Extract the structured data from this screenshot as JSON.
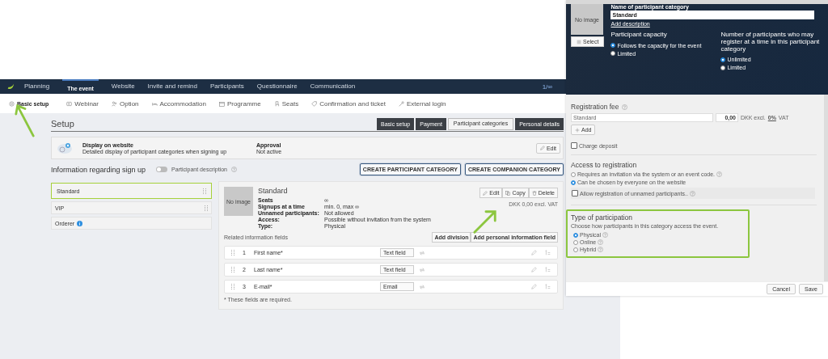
{
  "nav": {
    "items": [
      {
        "label": "Planning",
        "selected": false
      },
      {
        "label": "The event",
        "selected": true
      },
      {
        "label": "Website",
        "selected": false
      },
      {
        "label": "Invite and remind",
        "selected": false
      },
      {
        "label": "Participants",
        "selected": false
      },
      {
        "label": "Questionnaire",
        "selected": false
      },
      {
        "label": "Communication",
        "selected": false
      }
    ],
    "counter": "1/∞"
  },
  "subnav": [
    {
      "label": "Basic setup",
      "selected": true
    },
    {
      "label": "Webinar",
      "selected": false
    },
    {
      "label": "Option",
      "selected": false
    },
    {
      "label": "Accommodation",
      "selected": false
    },
    {
      "label": "Programme",
      "selected": false
    },
    {
      "label": "Seats",
      "selected": false
    },
    {
      "label": "Confirmation and ticket",
      "selected": false
    },
    {
      "label": "External login",
      "selected": false
    }
  ],
  "setup": {
    "title": "Setup",
    "tabs": [
      {
        "label": "Basic setup",
        "selected": false
      },
      {
        "label": "Payment",
        "selected": false
      },
      {
        "label": "Participant categories",
        "selected": true
      },
      {
        "label": "Personal details",
        "selected": false
      }
    ]
  },
  "display_info": {
    "title": "Display on website",
    "text": "Detailed display of participant categories when signing up",
    "approval_label": "Approval",
    "approval_value": "Not active",
    "edit": "Edit"
  },
  "signup": {
    "heading": "Information regarding sign up",
    "toggle": {
      "label": "Participant description",
      "on": false
    },
    "buttons": [
      "CREATE PARTICIPANT CATEGORY",
      "CREATE COMPANION CATEGORY"
    ]
  },
  "categories": [
    {
      "label": "Standard",
      "selected": true,
      "kind": "category"
    },
    {
      "label": "VIP",
      "selected": false,
      "kind": "category"
    },
    {
      "label": "Orderer",
      "selected": false,
      "kind": "orderer"
    }
  ],
  "detail": {
    "image": "No image",
    "name": "Standard",
    "props": [
      {
        "label": "Seats",
        "value": "∞"
      },
      {
        "label": "Signups at a time",
        "value": "min. 0, max ∞"
      },
      {
        "label": "Unnamed participants:",
        "value": "Not allowed"
      },
      {
        "label": "Access:",
        "value": "Possible without invitation from the system"
      },
      {
        "label": "Type:",
        "value": "Physical"
      }
    ],
    "actions": [
      "Edit",
      "Copy",
      "Delete"
    ],
    "price": "DKK 0,00 excl. VAT",
    "related_label": "Related information fields",
    "field_buttons": [
      "Add division",
      "Add personal information field"
    ],
    "fields": [
      {
        "number": "1",
        "name": "First name*",
        "type": "Text field"
      },
      {
        "number": "2",
        "name": "Last name*",
        "type": "Text field"
      },
      {
        "number": "3",
        "name": "E-mail*",
        "type": "Email"
      }
    ],
    "footnote": "* These fields are required."
  },
  "panel": {
    "image": "No image",
    "select": "Select",
    "name_label": "Name of participant category",
    "name_value": "Standard",
    "add_description": "Add description",
    "capacity": {
      "title": "Participant capacity",
      "options": [
        {
          "label": "Follows the capacity for the event",
          "selected": true
        },
        {
          "label": "Limited",
          "selected": false
        }
      ]
    },
    "per_signup": {
      "title": "Number of participants who may register at a time in this participant category",
      "options": [
        {
          "label": "Unlimited",
          "selected": true
        },
        {
          "label": "Limited",
          "selected": false
        }
      ]
    },
    "fee": {
      "title": "Registration fee",
      "name": "Standard",
      "amount": "0,00",
      "currency": "DKK excl.",
      "vat": "0%",
      "vat_suffix": "VAT",
      "add": "Add"
    },
    "deposit": {
      "label": "Charge deposit",
      "checked": false
    },
    "access": {
      "title": "Access to registration",
      "options": [
        {
          "label": "Requires an invitation via the system or an event code.",
          "selected": false
        },
        {
          "label": "Can be chosen by everyone on the website",
          "selected": true
        }
      ],
      "unnamed": {
        "label": "Allow registration of unnamed participants..",
        "checked": false
      }
    },
    "participation": {
      "title": "Type of participation",
      "text": "Choose how participants in this category access the event.",
      "options": [
        {
          "label": "Physical",
          "selected": true
        },
        {
          "label": "Online",
          "selected": false
        },
        {
          "label": "Hybrid",
          "selected": false
        }
      ]
    },
    "cancel": "Cancel",
    "save": "Save"
  }
}
